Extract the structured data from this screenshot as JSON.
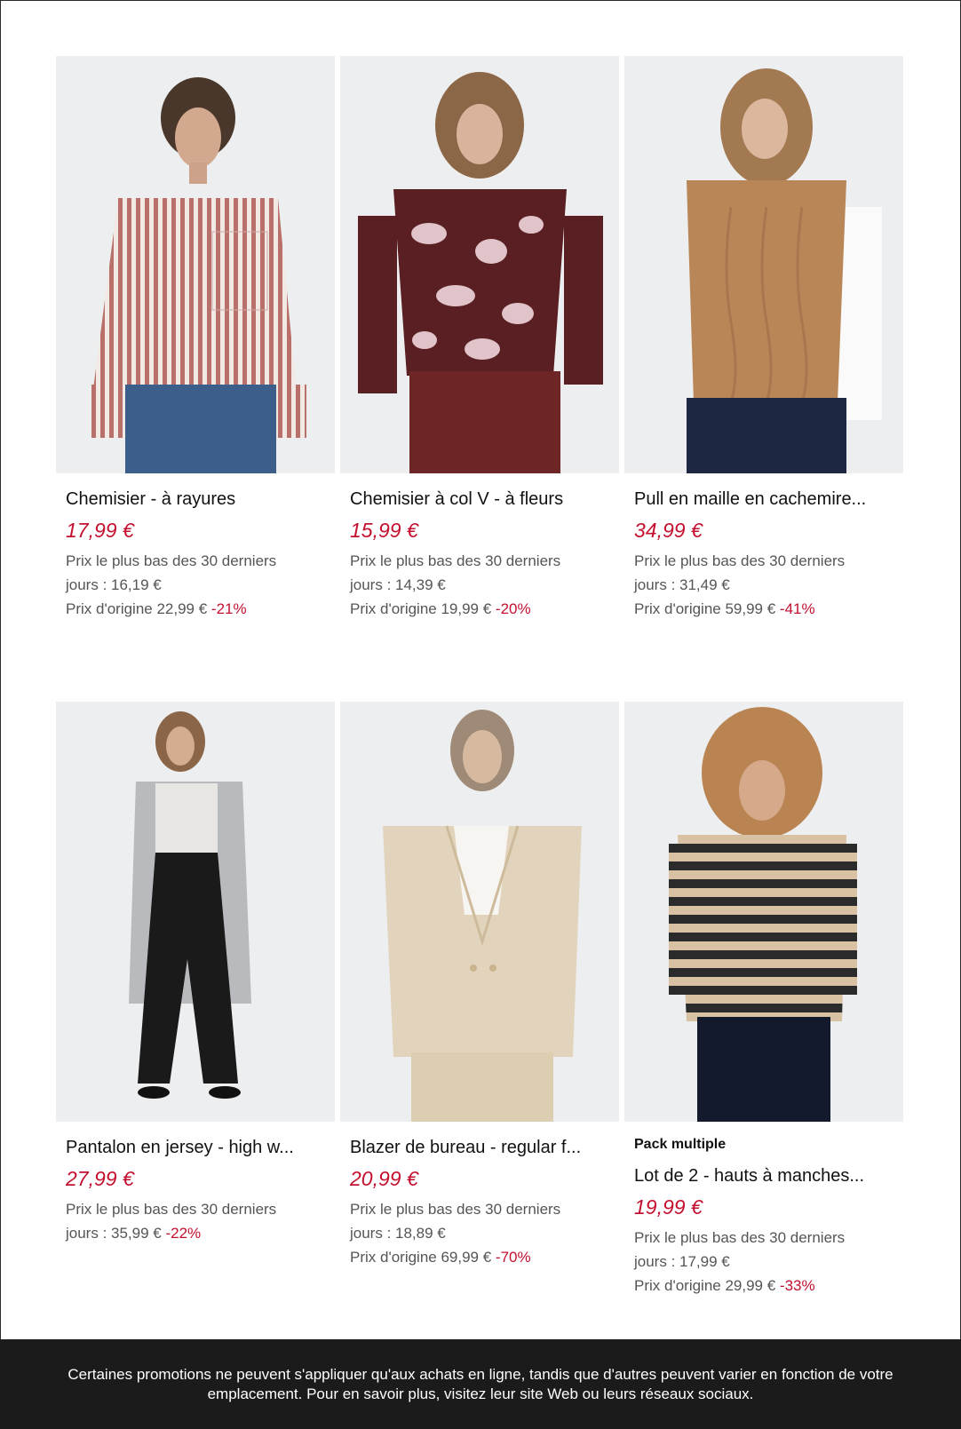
{
  "products": [
    {
      "title": "Chemisier - à rayures",
      "price": "17,99 €",
      "lowest_label": "Prix le plus bas des 30 derniers",
      "lowest_value": "jours : 16,19 €",
      "original": "Prix d'origine 22,99 €",
      "discount": "-21%",
      "image": "striped-shirt-photo"
    },
    {
      "title": "Chemisier à col V - à fleurs",
      "price": "15,99 €",
      "lowest_label": "Prix le plus bas des 30 derniers",
      "lowest_value": "jours : 14,39 €",
      "original": "Prix d'origine 19,99 €",
      "discount": "-20%",
      "image": "floral-blouse-photo"
    },
    {
      "title": "Pull en maille en cachemire...",
      "price": "34,99 €",
      "lowest_label": "Prix le plus bas des 30 derniers",
      "lowest_value": "jours : 31,49 €",
      "original": "Prix d'origine 59,99 €",
      "discount": "-41%",
      "image": "cable-knit-vest-photo"
    },
    {
      "title": "Pantalon en jersey - high w...",
      "price": "27,99 €",
      "lowest_label": "Prix le plus bas des 30 derniers",
      "lowest_value": "jours : 35,99 €",
      "discount": "-22%",
      "image": "jersey-trousers-photo"
    },
    {
      "title": "Blazer de bureau - regular f...",
      "price": "20,99 €",
      "lowest_label": "Prix le plus bas des 30 derniers",
      "lowest_value": "jours : 18,89 €",
      "original": "Prix d'origine 69,99 €",
      "discount": "-70%",
      "image": "beige-blazer-photo"
    },
    {
      "pack_label": "Pack multiple",
      "title": "Lot de 2 - hauts à manches...",
      "price": "19,99 €",
      "lowest_label": "Prix le plus bas des 30 derniers",
      "lowest_value": "jours : 17,99 €",
      "original": "Prix d'origine 29,99 €",
      "discount": "-33%",
      "image": "striped-top-photo"
    }
  ],
  "footer": {
    "text": "Certaines promotions ne peuvent s'appliquer qu'aux achats en ligne, tandis que d'autres peuvent varier en fonction de votre emplacement. Pour en savoir plus, visitez leur site Web ou leurs réseaux sociaux."
  },
  "colors": {
    "price": "#c3102f",
    "footer_bg": "#1b1b1b"
  }
}
